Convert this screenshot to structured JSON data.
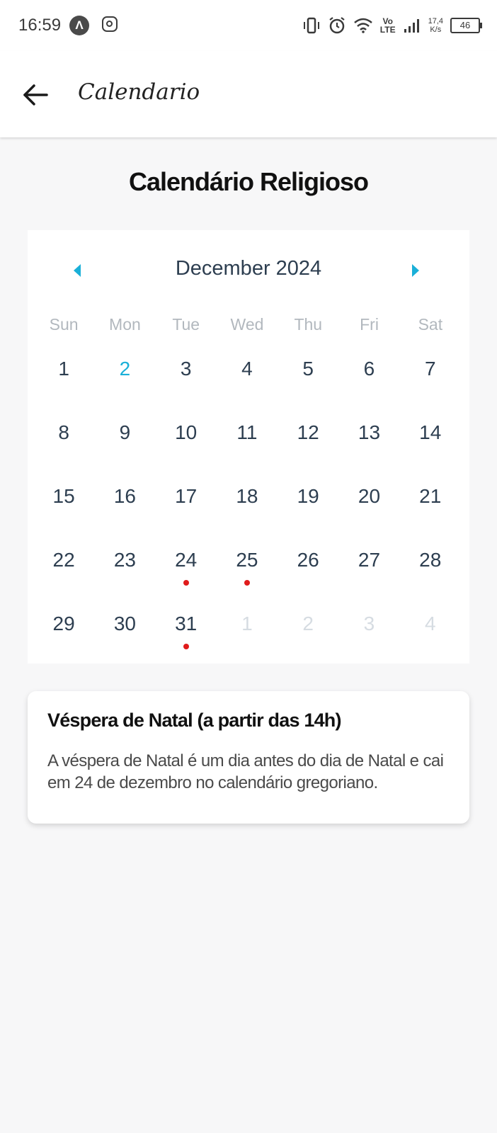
{
  "status_bar": {
    "time": "16:59",
    "lte_top": "Vo",
    "lte_bottom": "LTE",
    "speed_value": "17,4",
    "speed_unit": "K/s",
    "battery": "46"
  },
  "app_bar": {
    "title": "Calendario",
    "back_icon": "arrow-left-icon"
  },
  "page_title": "Calendário Religioso",
  "calendar": {
    "month_label": "December 2024",
    "accent_color": "#1ab0d8",
    "event_dot_color": "#e01b1b",
    "weekdays": [
      "Sun",
      "Mon",
      "Tue",
      "Wed",
      "Thu",
      "Fri",
      "Sat"
    ],
    "days": [
      {
        "label": "1",
        "state": "current"
      },
      {
        "label": "2",
        "state": "today"
      },
      {
        "label": "3",
        "state": "current"
      },
      {
        "label": "4",
        "state": "current"
      },
      {
        "label": "5",
        "state": "current"
      },
      {
        "label": "6",
        "state": "current"
      },
      {
        "label": "7",
        "state": "current"
      },
      {
        "label": "8",
        "state": "current"
      },
      {
        "label": "9",
        "state": "current"
      },
      {
        "label": "10",
        "state": "current"
      },
      {
        "label": "11",
        "state": "current"
      },
      {
        "label": "12",
        "state": "current"
      },
      {
        "label": "13",
        "state": "current"
      },
      {
        "label": "14",
        "state": "current"
      },
      {
        "label": "15",
        "state": "current"
      },
      {
        "label": "16",
        "state": "current"
      },
      {
        "label": "17",
        "state": "current"
      },
      {
        "label": "18",
        "state": "current"
      },
      {
        "label": "19",
        "state": "current"
      },
      {
        "label": "20",
        "state": "current"
      },
      {
        "label": "21",
        "state": "current"
      },
      {
        "label": "22",
        "state": "current"
      },
      {
        "label": "23",
        "state": "current"
      },
      {
        "label": "24",
        "state": "current",
        "event": true
      },
      {
        "label": "25",
        "state": "current",
        "event": true
      },
      {
        "label": "26",
        "state": "current"
      },
      {
        "label": "27",
        "state": "current"
      },
      {
        "label": "28",
        "state": "current"
      },
      {
        "label": "29",
        "state": "current"
      },
      {
        "label": "30",
        "state": "current"
      },
      {
        "label": "31",
        "state": "current",
        "event": true
      },
      {
        "label": "1",
        "state": "other"
      },
      {
        "label": "2",
        "state": "other"
      },
      {
        "label": "3",
        "state": "other"
      },
      {
        "label": "4",
        "state": "other"
      }
    ]
  },
  "event": {
    "title": "Véspera de Natal (a partir das 14h)",
    "description": "A véspera de Natal é um dia antes do dia de Natal e cai em 24 de dezembro no calendário gregoriano."
  }
}
